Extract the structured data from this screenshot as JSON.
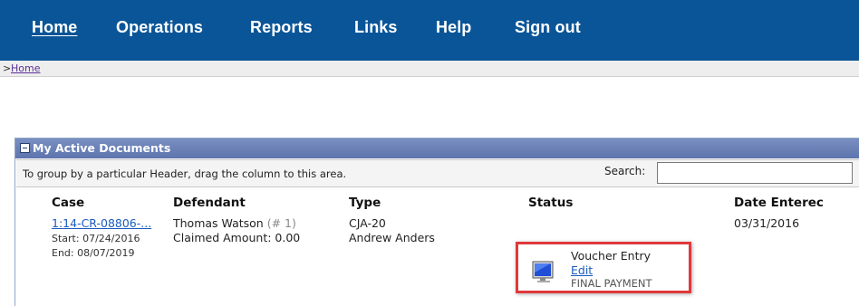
{
  "nav": {
    "items": [
      {
        "label": "Home"
      },
      {
        "label": "Operations"
      },
      {
        "label": "Reports"
      },
      {
        "label": "Links"
      },
      {
        "label": "Help"
      },
      {
        "label": "Sign out"
      }
    ]
  },
  "breadcrumb": {
    "separator": ">",
    "home_link": "Home"
  },
  "panel": {
    "title": "My Active Documents",
    "group_hint": "To group by a particular Header, drag the column to this area.",
    "search_label": "Search:",
    "search_value": ""
  },
  "grid": {
    "columns": [
      "Case",
      "Defendant",
      "Type",
      "Status",
      "Date Enterec"
    ],
    "rows": [
      {
        "case_link": "1:14-CR-08806-...",
        "start": "Start: 07/24/2016",
        "end": "End: 08/07/2019",
        "defendant": "Thomas Watson",
        "defendant_num": "(# 1)",
        "claimed": "Claimed Amount: 0.00",
        "type": "CJA-20",
        "attorney": "Andrew Anders",
        "status": "Voucher Entry",
        "status_action": "Edit",
        "status_sub": "FINAL PAYMENT",
        "date_entered": "03/31/2016"
      }
    ]
  },
  "icons": {
    "status_icon": "computer-monitor-icon",
    "collapse_icon": "collapse-minus-icon"
  },
  "colors": {
    "nav_bg": "#0a5597",
    "panel_header": "#6a80b7",
    "highlight_border": "#e0393b",
    "link": "#1a5bbf"
  }
}
